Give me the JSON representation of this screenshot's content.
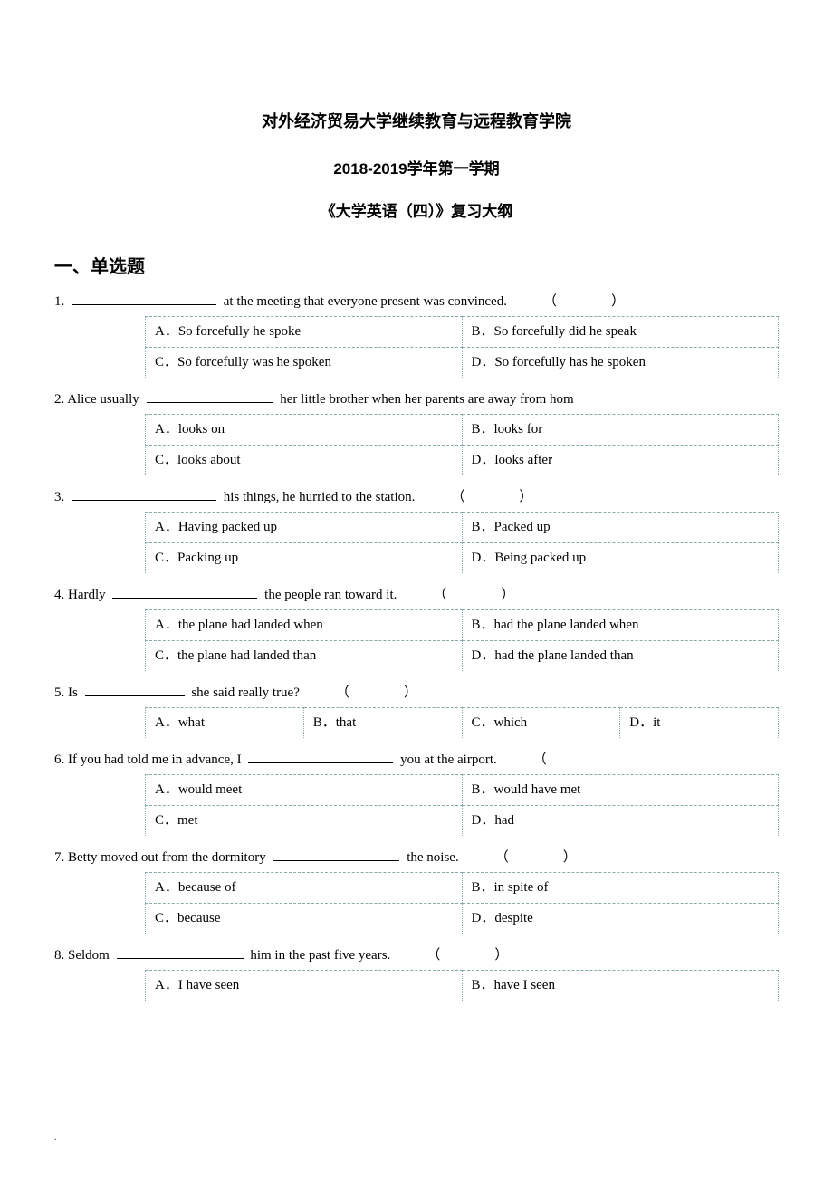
{
  "header": {
    "institution": "对外经济贸易大学继续教育与远程教育学院",
    "term": "2018-2019学年第一学期",
    "course": "《大学英语（四）》复习大纲"
  },
  "section_title": "一、单选题",
  "questions": [
    {
      "num": "1.",
      "before": "",
      "after": " at the meeting that everyone present was convinced.",
      "paren": true,
      "blank_class": "med",
      "layout": "two",
      "opts": [
        [
          "A．So forcefully he spoke",
          "B．So forcefully did he speak"
        ],
        [
          "C．So forcefully was he spoken",
          "D．So forcefully has he spoken"
        ]
      ]
    },
    {
      "num": "2.",
      "before": "Alice usually  ",
      "after": "  her little brother when her parents are away from hom",
      "paren": false,
      "blank_class": "",
      "layout": "two",
      "opts": [
        [
          "A．looks on",
          "B．looks for"
        ],
        [
          "C．looks about",
          "D．looks after"
        ]
      ]
    },
    {
      "num": "3.",
      "before": "",
      "after": " his things, he hurried to the station.",
      "paren": true,
      "blank_class": "med",
      "layout": "two",
      "opts": [
        [
          "A．Having packed up",
          "B．Packed up"
        ],
        [
          "C．Packing up",
          "D．Being packed up"
        ]
      ]
    },
    {
      "num": "4.",
      "before": "Hardly  ",
      "after": "  the people ran toward it.",
      "paren": true,
      "blank_class": "med",
      "layout": "two",
      "opts": [
        [
          "A．the plane had landed when",
          "B．had the plane landed when"
        ],
        [
          "C．the plane had landed than",
          "D．had the plane landed than"
        ]
      ]
    },
    {
      "num": "5.",
      "before": "Is  ",
      "after": "  she said really true?",
      "paren": true,
      "blank_class": "short",
      "layout": "four",
      "opts": [
        [
          "A．what",
          "B．that",
          "C．which",
          "D．it"
        ]
      ]
    },
    {
      "num": "6.",
      "before": "If you had told me in advance, I   ",
      "after": "  you at the airport.",
      "paren_only_open": true,
      "blank_class": "med",
      "layout": "two",
      "opts": [
        [
          "A．would meet",
          "B．would have met"
        ],
        [
          "C．met",
          "D．had"
        ]
      ]
    },
    {
      "num": "7.",
      "before": "Betty moved out from the dormitory   ",
      "after": "  the noise.",
      "paren": true,
      "blank_class": "",
      "layout": "two",
      "opts": [
        [
          "A．because of",
          "B．in spite of"
        ],
        [
          "C．because",
          "D．despite"
        ]
      ]
    },
    {
      "num": "8.",
      "before": "  Seldom  ",
      "after": "  him in the past five years.",
      "paren": true,
      "blank_class": "",
      "layout": "two",
      "opts": [
        [
          "A．I have seen",
          "B．have I seen"
        ]
      ]
    }
  ]
}
